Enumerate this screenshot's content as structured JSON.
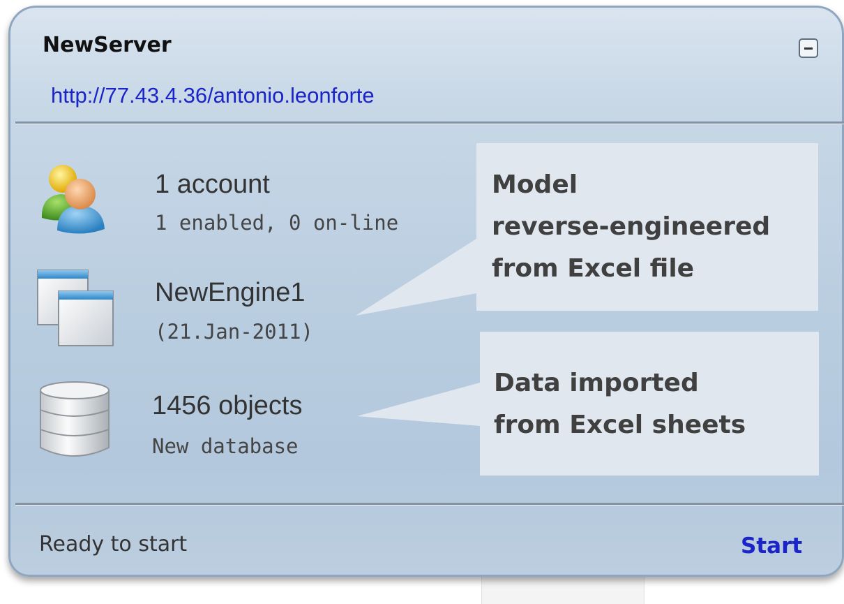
{
  "server": {
    "title": "NewServer",
    "url": "http://77.43.4.36/antonio.leonforte"
  },
  "rows": {
    "accounts": {
      "icon": "users-icon",
      "main": "1 account",
      "sub": "1 enabled, 0 on-line"
    },
    "engine": {
      "icon": "windows-icon",
      "main": "NewEngine1",
      "sub": "(21.Jan-2011)"
    },
    "database": {
      "icon": "database-icon",
      "main": "1456 objects",
      "sub": "New database"
    }
  },
  "callouts": {
    "model": {
      "lines": [
        "Model",
        "reverse-engineered",
        "from Excel file"
      ]
    },
    "data": {
      "lines": [
        "Data imported",
        "from Excel sheets"
      ]
    }
  },
  "footer": {
    "status": "Ready to start",
    "start_label": "Start"
  },
  "colors": {
    "link": "#1a24c8",
    "card_bg": "#c7d7e6",
    "callout_bg": "#e1e7ef",
    "callout_text": "#404040"
  }
}
